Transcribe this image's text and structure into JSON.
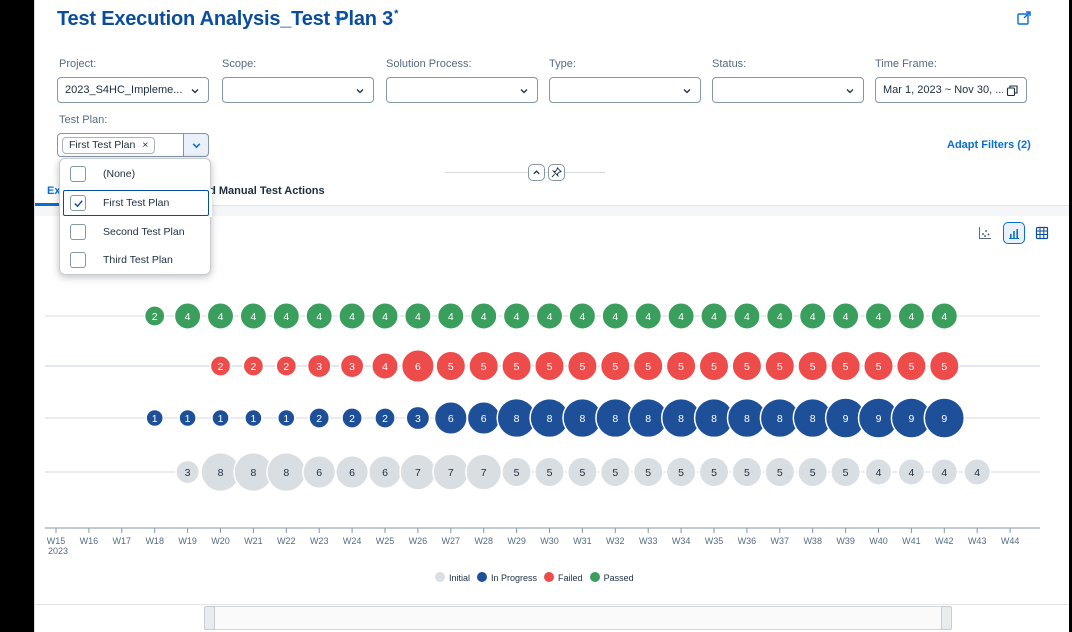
{
  "header": {
    "title": "Test Execution Analysis_Test Plan 3",
    "modified_marker": "*"
  },
  "filters": [
    {
      "label": "Project:",
      "value": "2023_S4HC_Impleme..."
    },
    {
      "label": "Scope:",
      "value": ""
    },
    {
      "label": "Solution Process:",
      "value": ""
    },
    {
      "label": "Type:",
      "value": ""
    },
    {
      "label": "Status:",
      "value": ""
    },
    {
      "label": "Time Frame:",
      "value": "Mar 1, 2023 ~ Nov 30, ..."
    }
  ],
  "test_plan": {
    "label": "Test Plan:",
    "token": "First Test Plan",
    "token_remove": "×"
  },
  "adapt_filters": "Adapt Filters (2)",
  "dropdown": {
    "items": [
      {
        "label": "(None)",
        "checked": false
      },
      {
        "label": "First Test Plan",
        "checked": true
      },
      {
        "label": "Second Test Plan",
        "checked": false
      },
      {
        "label": "Third Test Plan",
        "checked": false
      }
    ]
  },
  "tabs": {
    "partial": "Ex",
    "second": "ed Manual Test Actions"
  },
  "chart_data": {
    "type": "scatter",
    "weeks": [
      "W15",
      "W16",
      "W17",
      "W18",
      "W19",
      "W20",
      "W21",
      "W22",
      "W23",
      "W24",
      "W25",
      "W26",
      "W27",
      "W28",
      "W29",
      "W30",
      "W31",
      "W32",
      "W33",
      "W34",
      "W35",
      "W36",
      "W37",
      "W38",
      "W39",
      "W40",
      "W41",
      "W42",
      "W43",
      "W44"
    ],
    "year_label": "2023",
    "series": [
      {
        "name": "Passed",
        "color": "#3a9e5c",
        "start_week": "W18",
        "values": [
          2,
          4,
          4,
          4,
          4,
          4,
          4,
          4,
          4,
          4,
          4,
          4,
          4,
          4,
          4,
          4,
          4,
          4,
          4,
          4,
          4,
          4,
          4,
          4,
          4
        ]
      },
      {
        "name": "Failed",
        "color": "#ee4b4b",
        "start_week": "W20",
        "values": [
          2,
          2,
          2,
          3,
          3,
          4,
          6,
          5,
          5,
          5,
          5,
          5,
          5,
          5,
          5,
          5,
          5,
          5,
          5,
          5,
          5,
          5,
          5
        ]
      },
      {
        "name": "In Progress",
        "color": "#1e4f99",
        "start_week": "W18",
        "values": [
          1,
          1,
          1,
          1,
          1,
          2,
          2,
          2,
          3,
          6,
          6,
          8,
          8,
          8,
          8,
          8,
          8,
          8,
          8,
          8,
          8,
          9,
          9,
          9,
          9
        ]
      },
      {
        "name": "Initial",
        "color": "#d9dee3",
        "start_week": "W19",
        "values": [
          3,
          8,
          8,
          8,
          6,
          6,
          6,
          7,
          7,
          7,
          5,
          5,
          5,
          5,
          5,
          5,
          5,
          5,
          5,
          5,
          5,
          4,
          4,
          4,
          4
        ]
      }
    ],
    "legend_order": [
      "Initial",
      "In Progress",
      "Failed",
      "Passed"
    ],
    "legend_position": "bottom"
  }
}
